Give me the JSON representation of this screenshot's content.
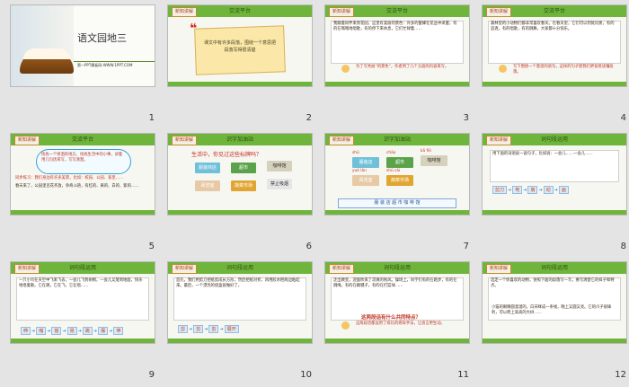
{
  "slides": [
    {
      "n": "1",
      "title": "语文园地三",
      "subtitle": "第一PPT模板网-WWW.1PPT.COM"
    },
    {
      "n": "2",
      "tag": "新知讲解",
      "title": "交流平台",
      "body": "课文中有许多段落，围绕一个意思把段落写得很清楚"
    },
    {
      "n": "3",
      "tag": "新知讲解",
      "title": "交流平台",
      "body": "我跟着同伴来到花园，这里有美丽的景色：许多的蜜蜂在花丛中采蜜，有的在嗡嗡地唱歌，有的停下来休息，它们忙碌着……",
      "note": "为了写秀丽“的景色”，作者用了几个方面的内容来写。"
    },
    {
      "n": "4",
      "tag": "新知讲解",
      "title": "交流平台",
      "body": "森林里的小动物们都非常喜欢春天。在春天里，它们可以到处玩耍，有的追逐，有的唱歌，有的跳舞，大家都十分快乐。",
      "note": "写下围绕一个意思的语句，这样的句子使我们更容易读懂段落。"
    },
    {
      "n": "5",
      "tag": "新知讲解",
      "title": "交流平台",
      "body": "找找一个喷洒的地方，找找生活中的小事，试着用几句话来写，写写清楚。",
      "extra": "同步练习：我们身边有许多美景，比如：校园、公园、家里……",
      "extra2": "春天来了，公园里百花齐放，争奇斗艳，有红的、黄的、白的、紫的……"
    },
    {
      "n": "6",
      "tag": "新知讲解",
      "title": "识字加油站",
      "body": "生活中，你见过这些标牌吗？",
      "cards": [
        "服装商店",
        "超市",
        "咖啡馆",
        "阅览室",
        "蔬菜市场",
        "禁止吸烟"
      ]
    },
    {
      "n": "7",
      "tag": "新知讲解",
      "title": "识字加油站",
      "cards": [
        "服装店",
        "超市",
        "咖啡馆",
        "阅览室",
        "蔬菜市场"
      ],
      "pinyin": [
        "shū",
        "chāo",
        "kā fēi",
        "yuè lǎn",
        "shū cài"
      ],
      "row": "服  装  店  超  市  咖  啡  馆"
    },
    {
      "n": "8",
      "tag": "新知讲解",
      "title": "词句段运用",
      "body": "用下面的词语说一说句子，比如说：一会儿……一会儿……",
      "chain": [
        "剪刀",
        "电",
        "扇",
        "动",
        "画"
      ]
    },
    {
      "n": "9",
      "tag": "新知讲解",
      "title": "词句段运用",
      "body": "一只小鸟在天空中飞来飞去，一会儿飞到树梢，一会儿又落到地面，快乐地唱着歌。它在跳，它在飞，它在唱……",
      "chain": [
        "伸",
        "缩",
        "摇",
        "晃",
        "跳",
        "摆",
        "伸"
      ]
    },
    {
      "n": "10",
      "tag": "新知讲解",
      "title": "词句段运用",
      "body": "首先，我们用剪刀把纸剪成长方形，然后把纸对折，再用胶水把两边粘起来。最后，一个漂亮的纸盒就做好了。",
      "chain": [
        "剪",
        "剪",
        "剪",
        "展开"
      ]
    },
    {
      "n": "11",
      "tag": "新知讲解",
      "title": "词句段运用",
      "body": "走出教室，迎面吹来了凉爽的秋风。操场上，同学们有的在跑步，有的在跳绳，有的在踢毽子，有的在打篮球……",
      "q": "这两段话有什么共同特点？",
      "note": "这两段话都运用了排比的修辞手法，让语言更生动。"
    },
    {
      "n": "12",
      "tag": "新知讲解",
      "title": "词句段运用",
      "body": "选定一个你喜欢的动物，仿照下面的段落写一写，要写清楚它的样子和特点。",
      "extra": "小猫的眼睛圆溜溜的，白天眯成一条线，晚上又圆又亮。它的爪子很锋利，可以爬上高高的大树……"
    }
  ]
}
